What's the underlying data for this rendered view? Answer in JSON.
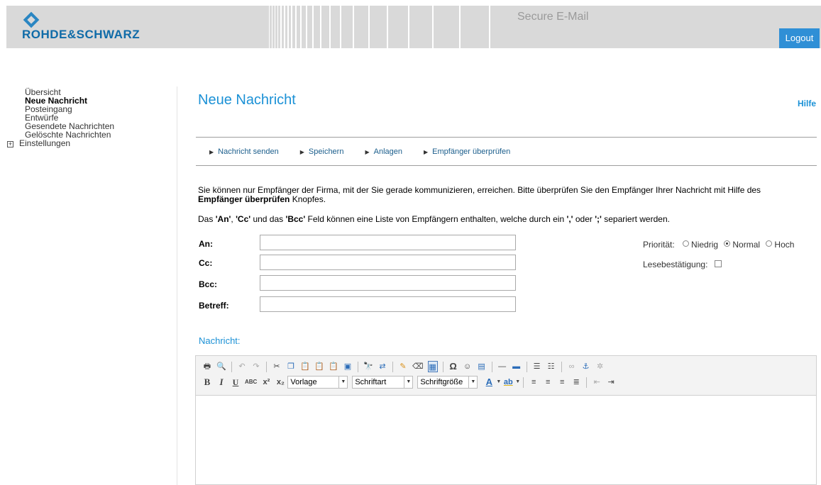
{
  "header": {
    "logo_text": "ROHDE&SCHWARZ",
    "app_title": "Secure E-Mail",
    "logout_label": "Logout"
  },
  "sidebar": {
    "items": [
      {
        "label": "Übersicht"
      },
      {
        "label": "Neue Nachricht"
      },
      {
        "label": "Posteingang"
      },
      {
        "label": "Entwürfe"
      },
      {
        "label": "Gesendete Nachrichten"
      },
      {
        "label": "Gelöschte Nachrichten"
      }
    ],
    "settings_label": "Einstellungen",
    "settings_expander": "+"
  },
  "main": {
    "title": "Neue Nachricht",
    "help_label": "Hilfe",
    "actions": [
      {
        "label": "Nachricht senden"
      },
      {
        "label": "Speichern"
      },
      {
        "label": "Anlagen"
      },
      {
        "label": "Empfänger überprüfen"
      }
    ],
    "info1_part1": "Sie können nur Empfänger der Firma, mit der Sie gerade kommunizieren, erreichen. Bitte überprüfen Sie den Empfänger Ihrer Nachricht mit Hilfe des",
    "info1_bold": "Empfänger überprüfen",
    "info1_part2": " Knopfes.",
    "info2": {
      "p1": "Das ",
      "an": "'An'",
      "s1": ", ",
      "cc": "'Cc'",
      "s2": " und das ",
      "bcc": "'Bcc'",
      "s3": " Feld können eine Liste von Empfängern enthalten, welche durch ein ",
      "comma": "','",
      "s4": " oder ",
      "semi": "';'",
      "s5": " separiert werden."
    },
    "fields": {
      "an_label": "An:",
      "cc_label": "Cc:",
      "bcc_label": "Bcc:",
      "betreff_label": "Betreff:",
      "an_value": "",
      "cc_value": "",
      "bcc_value": "",
      "betreff_value": ""
    },
    "priority": {
      "label": "Priorität:",
      "options": [
        "Niedrig",
        "Normal",
        "Hoch"
      ],
      "selected": "Normal"
    },
    "read_receipt": {
      "label": "Lesebestätigung:",
      "checked": false
    },
    "message_label": "Nachricht:"
  },
  "editor": {
    "style_select": "Vorlage",
    "font_select": "Schriftart",
    "size_select": "Schriftgröße",
    "bold": "B",
    "italic": "I",
    "underline": "U",
    "strike": "ABC",
    "superscript": "x²",
    "subscript": "x₂",
    "font_color": "A",
    "highlight": "ab",
    "body_text": ""
  },
  "colors": {
    "accent": "#1b91d6",
    "logout_bg": "#2f8fd6",
    "header_bg": "#d9d9d9"
  }
}
